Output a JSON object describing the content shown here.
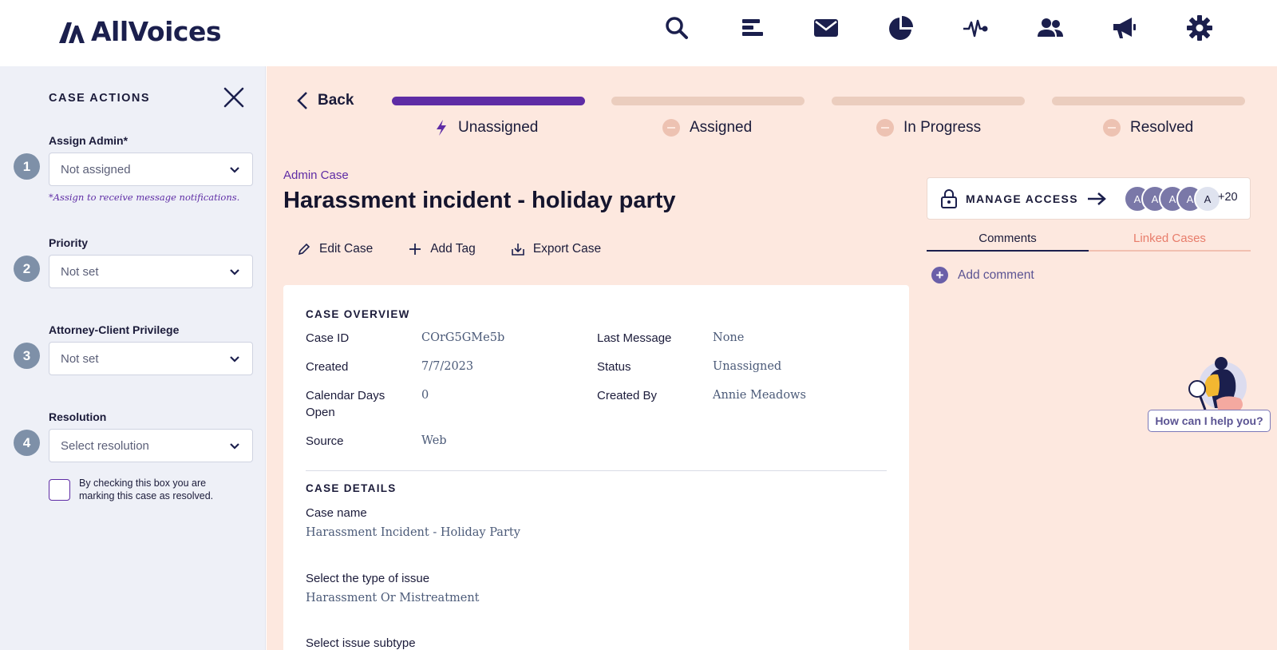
{
  "brand": {
    "name": "AllVoices"
  },
  "nav": {
    "icons": [
      "search-icon",
      "reports-icon",
      "messages-icon",
      "analytics-icon",
      "activity-icon",
      "users-icon",
      "announcements-icon",
      "settings-icon"
    ]
  },
  "sidebar": {
    "title": "CASE ACTIONS",
    "fields": [
      {
        "step": "1",
        "label": "Assign Admin*",
        "value": "Not assigned"
      },
      {
        "step": "2",
        "label": "Priority",
        "value": "Not set"
      },
      {
        "step": "3",
        "label": "Attorney-Client Privilege",
        "value": "Not set"
      },
      {
        "step": "4",
        "label": "Resolution",
        "value": "Select resolution"
      }
    ],
    "assign_hint": "*Assign to receive message notifications.",
    "resolve_checkbox_text": "By checking this box you are marking this case as resolved."
  },
  "main": {
    "back_label": "Back",
    "progress": {
      "current_stage": 1,
      "stages": [
        "Unassigned",
        "Assigned",
        "In Progress",
        "Resolved"
      ]
    },
    "breadcrumb": "Admin Case",
    "title": "Harassment incident - holiday party",
    "actions": {
      "edit": "Edit Case",
      "tag": "Add Tag",
      "export": "Export Case"
    },
    "overview": {
      "title": "CASE OVERVIEW",
      "left": [
        {
          "key": "Case ID",
          "value": "COrG5GMe5b"
        },
        {
          "key": "Created",
          "value": "7/7/2023"
        },
        {
          "key": "Calendar Days Open",
          "value": "0"
        },
        {
          "key": "Source",
          "value": "Web"
        }
      ],
      "right": [
        {
          "key": "Last Message",
          "value": "None"
        },
        {
          "key": "Status",
          "value": "Unassigned"
        },
        {
          "key": "Created By",
          "value": "Annie Meadows"
        }
      ]
    },
    "details": {
      "title": "CASE DETAILS",
      "items": [
        {
          "label": "Case name",
          "value": "Harassment Incident - Holiday Party"
        },
        {
          "label": "Select the type of issue",
          "value": "Harassment Or Mistreatment"
        },
        {
          "label": "Select issue subtype",
          "value": ""
        }
      ]
    }
  },
  "right_panel": {
    "manage_access": "MANAGE ACCESS",
    "avatars": [
      "A",
      "A",
      "A",
      "A",
      "A"
    ],
    "more_count": "+20",
    "tabs": {
      "comments": "Comments",
      "linked": "Linked Cases"
    },
    "add_comment": "Add comment",
    "helper": "How can I help you?"
  },
  "colors": {
    "brand_purple": "#5e2ca5",
    "navy": "#1b1f4d",
    "main_bg": "#fde8df",
    "sidebar_bg": "#eef0f7",
    "step_badge": "#7e90a8",
    "linked_tab": "#e87d6b"
  }
}
